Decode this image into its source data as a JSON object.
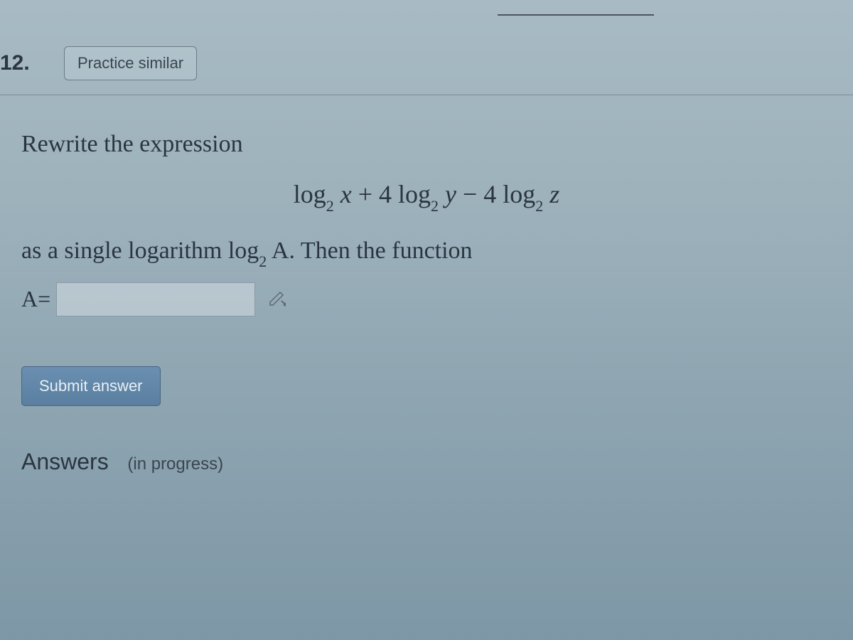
{
  "header": {
    "question_number": "12.",
    "practice_button": "Practice similar"
  },
  "problem": {
    "prompt_line1": "Rewrite the expression",
    "expression_html": "log<span class=\"sub\">2</span> <span class=\"var\">x</span> + 4 log<span class=\"sub\">2</span> <span class=\"var\">y</span> − 4 log<span class=\"sub\">2</span> <span class=\"var\">z</span>",
    "prompt_line2_html": "as a single logarithm log<span class=\"sub\">2</span> <span class=\"var\">A</span>. Then the function",
    "input_label": "A=",
    "input_value": ""
  },
  "buttons": {
    "submit": "Submit answer"
  },
  "answers_section": {
    "title": "Answers",
    "status": "(in progress)"
  }
}
